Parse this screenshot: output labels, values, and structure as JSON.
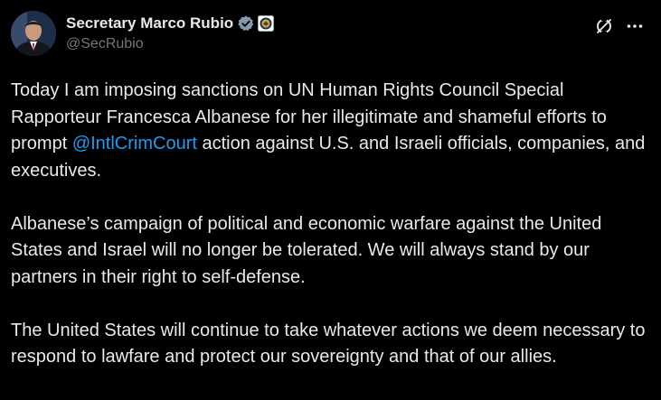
{
  "author": {
    "display_name": "Secretary Marco Rubio",
    "handle": "@SecRubio",
    "verified_badge_icon": "verified-badge-icon",
    "affiliation_icon": "state-department-seal-icon"
  },
  "actions": {
    "grok_icon": "grok-icon",
    "more_icon": "more-options-icon"
  },
  "colors": {
    "background": "#000000",
    "text": "#e7e9ea",
    "muted": "#71767b",
    "link": "#1d9bf0",
    "verified": "#829aab"
  },
  "post": {
    "p1_before": "Today I am imposing sanctions on UN Human Rights Council Special Rapporteur Francesca Albanese for her illegitimate and shameful efforts to prompt ",
    "p1_mention": "@IntlCrimCourt",
    "p1_after": " action against U.S. and Israeli officials, companies, and executives.",
    "p2": "Albanese’s campaign of political and economic warfare against the United States and Israel will no longer be tolerated. We will always stand by our partners in their right to self-defense.",
    "p3": "The United States will continue to take whatever actions we deem necessary to respond to lawfare and protect our sovereignty and that of our allies."
  }
}
